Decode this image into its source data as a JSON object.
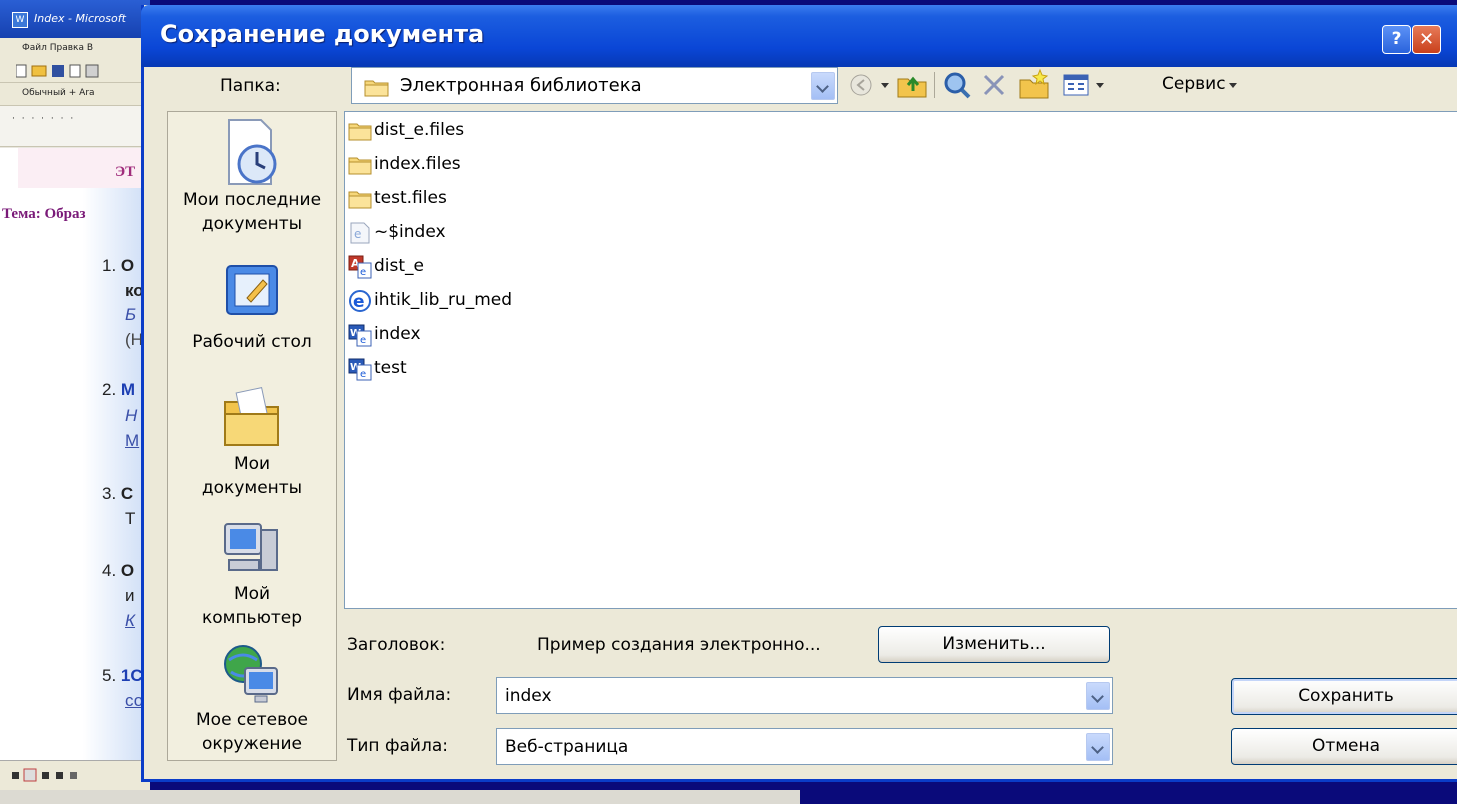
{
  "background_window": {
    "title": "Index - Microsoft",
    "menu": "Файл  Правка  В",
    "style_box": "Обычный + Ara",
    "heading_fragment": "ЭТ",
    "tema_fragment": "Тема: Образ",
    "items": [
      {
        "num": "1.",
        "letter": "О",
        "line2": "ко",
        "line3": "Б",
        "line4": "(Н"
      },
      {
        "num": "2.",
        "letter": "М",
        "line2": "Н",
        "line3": "М"
      },
      {
        "num": "3.",
        "letter": "С",
        "line2": "Т"
      },
      {
        "num": "4.",
        "letter": "О",
        "line2": "и",
        "line3": "К"
      },
      {
        "num": "5.",
        "letter": "1С",
        "line2": "со"
      }
    ]
  },
  "dialog": {
    "title": "Сохранение документа",
    "help_label": "?",
    "close_label": "✕",
    "folder_label": "Папка:",
    "folder_value": "Электронная библиотека",
    "service_label": "Сервис",
    "places": [
      {
        "id": "recent",
        "label_lines": [
          "Мои последние",
          "документы"
        ]
      },
      {
        "id": "desktop",
        "label_lines": [
          "Рабочий стол"
        ]
      },
      {
        "id": "mydocs",
        "label_lines": [
          "Мои",
          "документы"
        ]
      },
      {
        "id": "mycomputer",
        "label_lines": [
          "Мой",
          "компьютер"
        ]
      },
      {
        "id": "network",
        "label_lines": [
          "Мое сетевое",
          "окружение"
        ]
      }
    ],
    "files": [
      {
        "name": "dist_e.files",
        "icon": "folder-icon"
      },
      {
        "name": "index.files",
        "icon": "folder-icon"
      },
      {
        "name": "test.files",
        "icon": "folder-icon"
      },
      {
        "name": "~$index",
        "icon": "ie-page-icon"
      },
      {
        "name": "dist_e",
        "icon": "access-icon"
      },
      {
        "name": "ihtik_lib_ru_med",
        "icon": "ie-icon"
      },
      {
        "name": "index",
        "icon": "word-icon"
      },
      {
        "name": "test",
        "icon": "word-icon"
      }
    ],
    "title_label": "Заголовок:",
    "title_value": "Пример создания электронно...",
    "change_button": "Изменить...",
    "filename_label": "Имя файла:",
    "filename_value": "index",
    "filetype_label": "Тип файла:",
    "filetype_value": "Веб-страница",
    "save_button": "Сохранить",
    "cancel_button": "Отмена"
  }
}
